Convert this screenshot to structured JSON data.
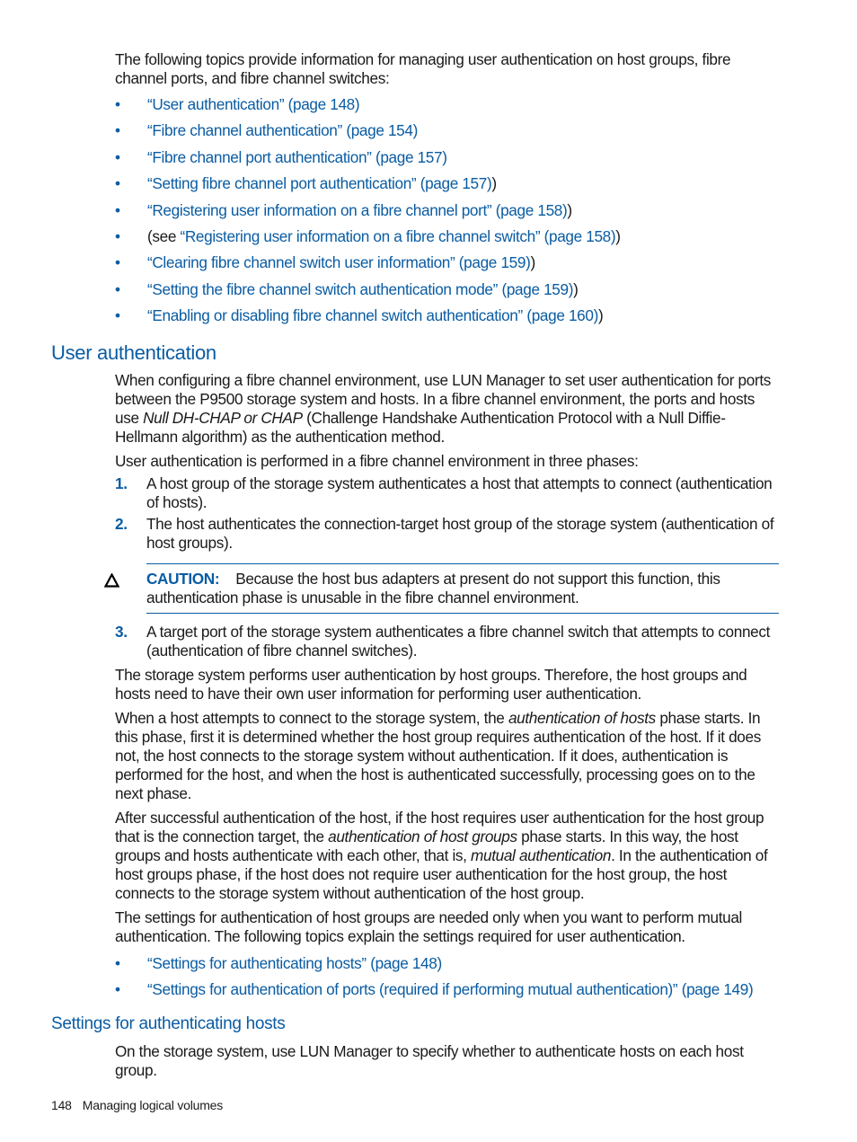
{
  "intro": {
    "text": "The following topics provide information for managing user authentication on host groups, fibre channel ports, and fibre channel switches:",
    "links": [
      {
        "prefix": "",
        "link": "“User authentication” (page 148)",
        "suffix": ""
      },
      {
        "prefix": "",
        "link": "“Fibre channel authentication” (page 154)",
        "suffix": ""
      },
      {
        "prefix": "",
        "link": "“Fibre channel port authentication” (page 157)",
        "suffix": ""
      },
      {
        "prefix": "",
        "link": "“Setting fibre channel port authentication” (page 157)",
        "suffix": ")"
      },
      {
        "prefix": "",
        "link": "“Registering user information on a fibre channel port” (page 158)",
        "suffix": ")"
      },
      {
        "prefix": "(see ",
        "link": "“Registering user information on a fibre channel switch” (page 158)",
        "suffix": ")"
      },
      {
        "prefix": "",
        "link": "“Clearing fibre channel switch user information” (page 159)",
        "suffix": ")"
      },
      {
        "prefix": "",
        "link": "“Setting the fibre channel switch authentication mode” (page 159)",
        "suffix": ")"
      },
      {
        "prefix": "",
        "link": "“Enabling or disabling fibre channel switch authentication” (page 160)",
        "suffix": ")"
      }
    ]
  },
  "section_user_auth": {
    "heading": "User authentication",
    "p1_a": "When configuring a fibre channel environment, use LUN Manager to set user authentication for ports between the P9500 storage system and hosts. In a fibre channel environment, the ports and hosts use ",
    "p1_em": "Null DH-CHAP or CHAP",
    "p1_b": " (Challenge Handshake Authentication Protocol with a Null Diffie-Hellmann algorithm) as the authentication method.",
    "p2": "User authentication is performed in a fibre channel environment in three phases:",
    "steps": [
      {
        "num": "1.",
        "text": "A host group of the storage system authenticates a host that attempts to connect (authentication of hosts)."
      },
      {
        "num": "2.",
        "text": "The host authenticates the connection-target host group of the storage system (authentication of host groups)."
      },
      {
        "num": "3.",
        "text": "A target port of the storage system authenticates a fibre channel switch that attempts to connect (authentication of fibre channel switches)."
      }
    ],
    "caution": {
      "icon": "caution-triangle-icon",
      "label": "CAUTION:",
      "text": "Because the host bus adapters at present do not support this function, this authentication phase is unusable in the fibre channel environment."
    },
    "p3": "The storage system performs user authentication by host groups. Therefore, the host groups and hosts need to have their own user information for performing user authentication.",
    "p4_a": "When a host attempts to connect to the storage system, the ",
    "p4_em": "authentication of hosts",
    "p4_b": " phase starts. In this phase, first it is determined whether the host group requires authentication of the host. If it does not, the host connects to the storage system without authentication. If it does, authentication is performed for the host, and when the host is authenticated successfully, processing goes on to the next phase.",
    "p5_a": "After successful authentication of the host, if the host requires user authentication for the host group that is the connection target, the ",
    "p5_em1": "authentication of host groups",
    "p5_b": " phase starts. In this way, the host groups and hosts authenticate with each other, that is, ",
    "p5_em2": "mutual authentication",
    "p5_c": ". In the authentication of host groups phase, if the host does not require user authentication for the host group, the host connects to the storage system without authentication of the host group.",
    "p6": "The settings for authentication of host groups are needed only when you want to perform mutual authentication. The following topics explain the settings required for user authentication.",
    "links": [
      "“Settings for authenticating hosts” (page 148)",
      "“Settings for authentication of ports (required if performing mutual authentication)” (page 149)"
    ]
  },
  "section_settings": {
    "heading": "Settings for authenticating hosts",
    "p1": "On the storage system, use LUN Manager to specify whether to authenticate hosts on each host group."
  },
  "footer": {
    "page_number": "148",
    "chapter": "Managing logical volumes"
  },
  "colors": {
    "link": "#0a5ca3",
    "text": "#1a1a1a"
  }
}
